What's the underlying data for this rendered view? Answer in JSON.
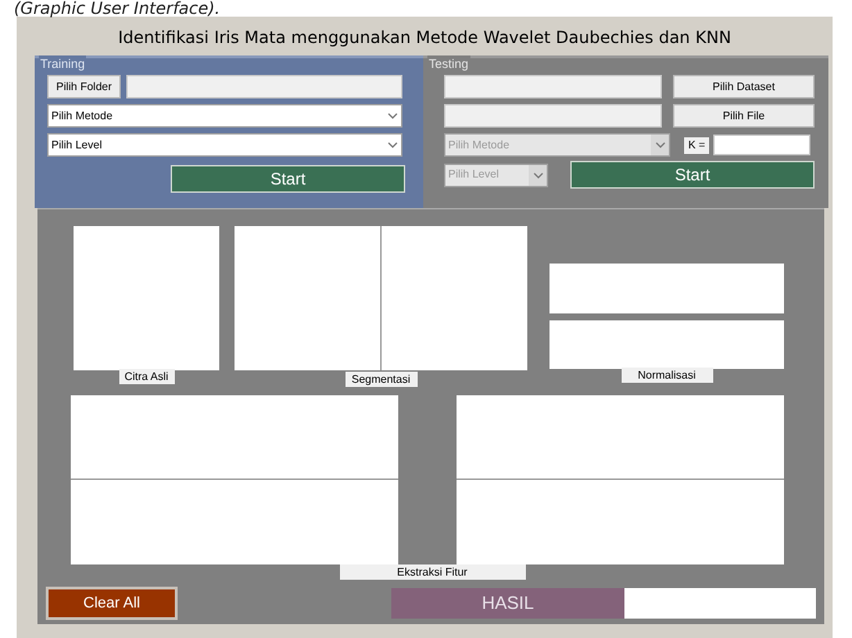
{
  "caption": "(Graphic User Interface).",
  "window": {
    "title": "Identifikasi Iris Mata menggunakan Metode Wavelet Daubechies dan KNN"
  },
  "training": {
    "title": "Training",
    "folder_button": "Pilih Folder",
    "method": {
      "placeholder": "Pilih Metode",
      "disabled": false
    },
    "level": {
      "placeholder": "Pilih Level",
      "disabled": false
    },
    "start": "Start"
  },
  "testing": {
    "title": "Testing",
    "dataset_button": "Pilih Dataset",
    "file_button": "Pilih File",
    "method": {
      "placeholder": "Pilih Metode",
      "disabled": true
    },
    "level": {
      "placeholder": "Pilih Level",
      "disabled": true
    },
    "k_label": "K =",
    "start": "Start"
  },
  "panels": {
    "original": "Citra Asli",
    "segmentation": "Segmentasi",
    "normalization": "Normalisasi",
    "features": "Ekstraksi Fitur"
  },
  "clear_button": "Clear All",
  "result_label": "HASIL"
}
